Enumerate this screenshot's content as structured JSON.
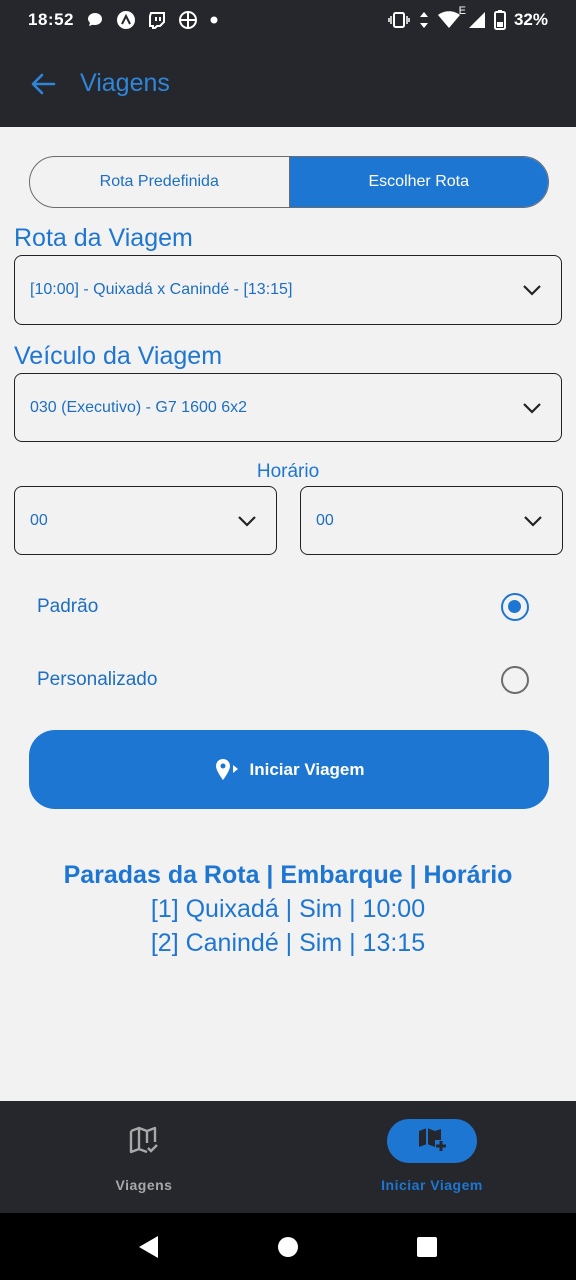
{
  "status_bar": {
    "time": "18:52",
    "battery": "32%",
    "left_icons": [
      "chat-bubble-icon",
      "app-a-icon",
      "twitch-icon",
      "target-icon",
      "dot-icon"
    ],
    "right_icons": [
      "vibrate-icon",
      "data-arrows-icon",
      "wifi-icon",
      "signal-icon",
      "battery-icon"
    ],
    "network_letter": "E"
  },
  "app_bar": {
    "title": "Viagens"
  },
  "segmented": {
    "predefined": "Rota Predefinida",
    "choose": "Escolher Rota",
    "selected": "choose"
  },
  "route": {
    "label": "Rota da Viagem",
    "value": "[10:00] - Quixadá  x Canindé  - [13:15]"
  },
  "vehicle": {
    "label": "Veículo da Viagem",
    "value": "030 (Executivo) - G7 1600 6x2"
  },
  "time": {
    "label": "Horário",
    "hour": "00",
    "minute": "00"
  },
  "options": {
    "standard": "Padrão",
    "custom": "Personalizado",
    "selected": "standard"
  },
  "start_button": {
    "label": "Iniciar Viagem"
  },
  "stops": {
    "header": "Paradas da Rota | Embarque | Horário",
    "lines": [
      "[1] Quixadá  | Sim | 10:00",
      "[2] Canindé  | Sim | 13:15"
    ]
  },
  "bottom_nav": {
    "items": [
      {
        "label": "Viagens",
        "icon": "map-check-icon",
        "active": false
      },
      {
        "label": "Iniciar Viagem",
        "icon": "map-plus-icon",
        "active": true
      }
    ]
  },
  "colors": {
    "accent": "#1e76d3",
    "dark": "#25272c",
    "background": "#f2f2f2"
  }
}
